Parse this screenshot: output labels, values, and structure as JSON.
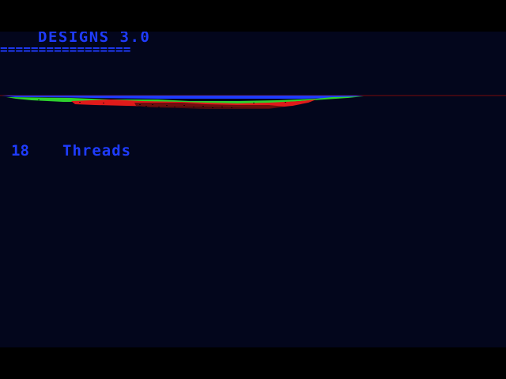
{
  "app": {
    "title": "DESIGNS 3.0",
    "underline": "================="
  },
  "status": {
    "count": "18",
    "label": "Threads"
  },
  "colors": {
    "text": "#1f3cff",
    "background": "#03061c",
    "border": "#000000",
    "baseline": "#7a0a0a",
    "thread_blue": "#1f3cff",
    "thread_green": "#2ed12e",
    "thread_red": "#e01a1a"
  }
}
